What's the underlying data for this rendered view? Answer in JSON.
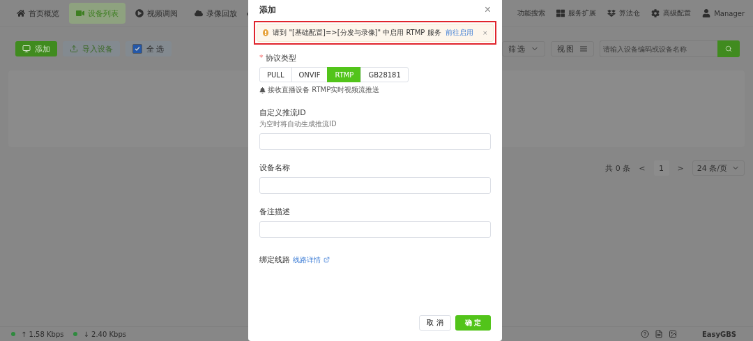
{
  "nav": {
    "left_items": [
      {
        "label": "首页概览",
        "selected": false
      },
      {
        "label": "设备列表",
        "selected": true
      },
      {
        "label": "视频调阅",
        "selected": false
      },
      {
        "label": "录像回放",
        "selected": false
      }
    ],
    "right_items": [
      {
        "label": "功能搜索"
      },
      {
        "label": "服务扩展"
      },
      {
        "label": "算法仓"
      },
      {
        "label": "高级配置"
      }
    ],
    "user": "Manager"
  },
  "toolbar": {
    "add": "添加",
    "import": "导入设备",
    "select_all": {
      "label": "全 选",
      "checked": true
    },
    "filter": "筛选",
    "view": "视图",
    "search": {
      "placeholder": "请输入设备编码或设备名称"
    }
  },
  "pagination": {
    "total": "共 0 条",
    "prev": "<",
    "page": "1",
    "next": ">",
    "page_size": "24 条/页"
  },
  "status_bar": {
    "upload": "↑ 1.58 Kbps",
    "download": "↓ 2.40 Kbps",
    "brand": "EasyGBS"
  },
  "dialog": {
    "title": "添加",
    "close": "×",
    "alert": {
      "message": "请到 \"[基础配置]=>[分发与录像]\" 中启用 RTMP 服务",
      "link": "前往启用",
      "close": "×",
      "highlighted": true
    },
    "protocol": {
      "label": "协议类型",
      "required": true,
      "required_mark": "*",
      "options": [
        {
          "label": "PULL",
          "selected": false
        },
        {
          "label": "ONVIF",
          "selected": false
        },
        {
          "label": "RTMP",
          "selected": true
        },
        {
          "label": "GB28181",
          "selected": false
        }
      ],
      "hint": "接收直播设备 RTMP实时视频流推送"
    },
    "fields": [
      {
        "label": "自定义推流ID",
        "help": "为空时将自动生成推流ID"
      },
      {
        "label": "设备名称"
      },
      {
        "label": "备注描述"
      }
    ],
    "route": {
      "label": "绑定线路",
      "link": "线路详情"
    },
    "buttons": {
      "cancel": "取 消",
      "ok": "确 定"
    }
  }
}
